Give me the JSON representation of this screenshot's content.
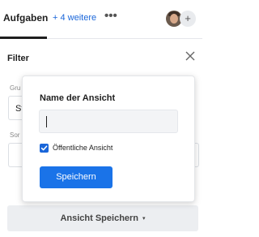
{
  "tabs": {
    "active_label": "Aufgaben",
    "more_label": "+ 4 weitere",
    "more_menu": "•••"
  },
  "header": {
    "add_symbol": "+"
  },
  "filter": {
    "title": "Filter",
    "field1_label": "Gru",
    "field1_value": "St",
    "field2_label": "Sor"
  },
  "popover": {
    "title": "Name der Ansicht",
    "input_value": "",
    "public_checkbox_checked": true,
    "public_checkbox_label": "Öffentliche Ansicht",
    "save_label": "Speichern"
  },
  "footer": {
    "save_view_label": "Ansicht Speichern",
    "caret": "▾"
  },
  "colors": {
    "accent": "#1a73e8",
    "link": "#1a66d9"
  }
}
